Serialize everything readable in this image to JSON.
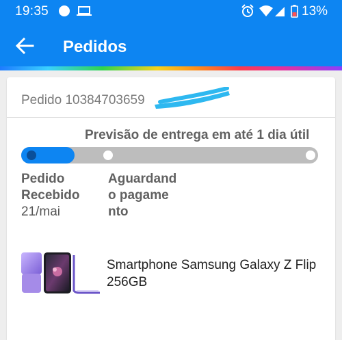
{
  "status_bar": {
    "time": "19:35",
    "battery_percent": "13%",
    "icons": [
      "notification-dot-icon",
      "laptop-icon",
      "alarm-icon",
      "wifi-icon",
      "cellular-signal-icon",
      "battery-low-icon"
    ]
  },
  "header": {
    "title": "Pedidos",
    "background_color": "#0d85f2",
    "back_icon": "arrow-left-icon"
  },
  "order": {
    "id_label": "Pedido 10384703659",
    "delivery_forecast": "Previsão de entrega em até 1 dia útil",
    "progress": {
      "current_step": 1,
      "total_steps": 3,
      "active_color": "#0d85f2",
      "inactive_color": "#bdbdbd"
    },
    "steps": [
      {
        "label_lines": [
          "Pedido",
          "Recebido"
        ],
        "date": "21/mai"
      },
      {
        "label_lines": [
          "Aguardand",
          "o pagame",
          "nto"
        ],
        "date": ""
      }
    ],
    "product": {
      "name": "Smartphone Samsung Galaxy Z Flip 256GB"
    }
  }
}
